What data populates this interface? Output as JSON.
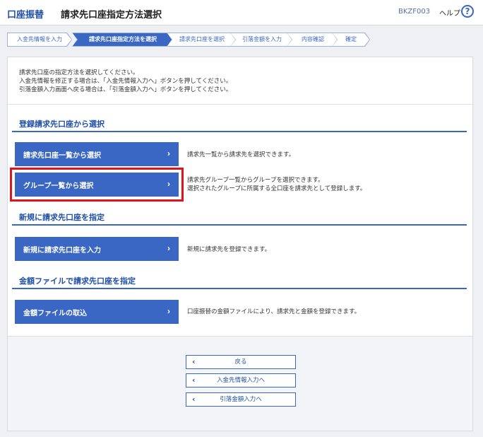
{
  "header": {
    "service": "口座振替",
    "title": "請求先口座指定方法選択",
    "screen_id": "BKZF003",
    "help_label": "ヘルプ",
    "help_icon_glyph": "?"
  },
  "steps": [
    {
      "label": "入金先情報を入力",
      "active": false
    },
    {
      "label": "請求先口座指定方法を選択",
      "active": true
    },
    {
      "label": "請求先口座を選択",
      "active": false
    },
    {
      "label": "引落金額を入力",
      "active": false
    },
    {
      "label": "内容確認",
      "active": false
    },
    {
      "label": "確定",
      "active": false
    }
  ],
  "intro": [
    "請求先口座の指定方法を選択してください。",
    "入金先情報を修正する場合は、「入金先情報入力へ」ボタンを押してください。",
    "引落金額入力画面へ戻る場合は、「引落金額入力へ」ボタンを押してください。"
  ],
  "sections": {
    "registered": {
      "title": "登録請求先口座から選択",
      "list_button": "請求先口座一覧から選択",
      "list_desc": "請求先一覧から請求先を選択できます。",
      "group_button": "グループ一覧から選択",
      "group_desc_1": "請求先グループ一覧からグループを選択できます。",
      "group_desc_2": "選択されたグループに所属する全口座を請求先として登録します。"
    },
    "new": {
      "title": "新規に請求先口座を指定",
      "button": "新規に請求先口座を入力",
      "desc": "新規に請求先を登録できます。"
    },
    "file": {
      "title": "金額ファイルで請求先口座を指定",
      "button": "金額ファイルの取込",
      "desc": "口座振替の金額ファイルにより、請求先と金額を登録できます。"
    }
  },
  "chevron_right": "›",
  "chevron_left": "‹",
  "nav": {
    "back": "戻る",
    "to_deposit": "入金先情報入力へ",
    "to_amount": "引落金額入力へ"
  },
  "colors": {
    "primary": "#3a66c4",
    "title_blue": "#1f4fa6",
    "highlight": "#e0141e"
  }
}
